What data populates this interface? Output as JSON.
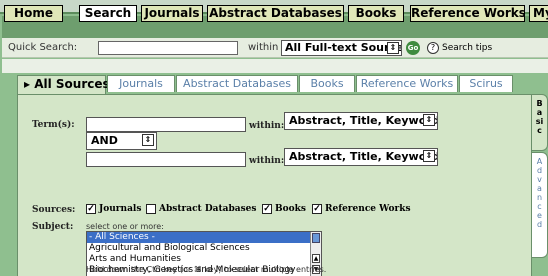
{
  "nav": {
    "items": [
      {
        "label": "Home",
        "active": false
      },
      {
        "label": "Search",
        "active": true
      },
      {
        "label": "Journals",
        "active": false
      },
      {
        "label": "Abstract Databases",
        "active": false
      },
      {
        "label": "Books",
        "active": false
      },
      {
        "label": "Reference Works",
        "active": false
      },
      {
        "label": "My Profile",
        "active": false
      }
    ]
  },
  "quick_search": {
    "label": "Quick Search:",
    "value": "",
    "within_label": "within",
    "within_value": "All Full-text Sources",
    "go_label": "Go",
    "help_label": "Search tips"
  },
  "tabs": [
    {
      "label": "All Sources",
      "active": true
    },
    {
      "label": "Journals",
      "active": false
    },
    {
      "label": "Abstract Databases",
      "active": false
    },
    {
      "label": "Books",
      "active": false
    },
    {
      "label": "Reference Works",
      "active": false
    },
    {
      "label": "Scirus",
      "active": false
    }
  ],
  "side_tabs": {
    "basic": "Basic",
    "advanced": "Advanced"
  },
  "form": {
    "terms_label": "Term(s):",
    "term1_value": "",
    "term2_value": "",
    "within_label": "within:",
    "within1_value": "Abstract, Title, Keywords",
    "within2_value": "Abstract, Title, Keywords",
    "operator_value": "AND",
    "sources_label": "Sources:",
    "sources": [
      {
        "label": "Journals",
        "checked": true
      },
      {
        "label": "Abstract Databases",
        "checked": false
      },
      {
        "label": "Books",
        "checked": true
      },
      {
        "label": "Reference Works",
        "checked": true
      }
    ],
    "subject_label": "Subject:",
    "subject_hint": "select one or more:",
    "subjects": [
      {
        "label": "- All Sciences -",
        "selected": true
      },
      {
        "label": "Agricultural and Biological Sciences",
        "selected": false
      },
      {
        "label": "Arts and Humanities",
        "selected": false
      },
      {
        "label": "Biochemistry, Genetics and Molecular Biology",
        "selected": false
      }
    ],
    "multi_select_hint": "Hold down the Ctrl key (or ⌘ key) to select multiple entries."
  },
  "colors": {
    "frame_green": "#8fbf8f",
    "nav_bar": "#6e9e6e",
    "nav_button": "#dfe7b8",
    "panel": "#d4e6c8",
    "tab_text": "#5a7fa8",
    "go_green": "#3f8b3f",
    "selected_item": "#3b6fc7"
  },
  "icons": {
    "go": "go-button-icon",
    "help": "question-mark-icon",
    "select_arrows": "up-down-arrows-icon",
    "tab_arrow": "triangle-right-icon"
  }
}
